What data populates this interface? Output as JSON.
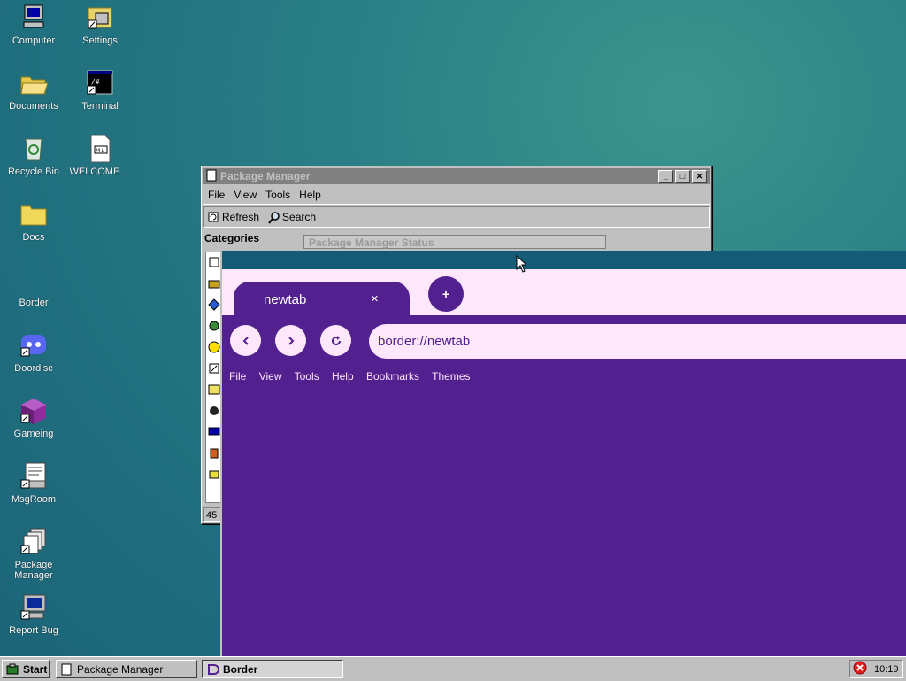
{
  "desktop": {
    "icons": [
      {
        "label": "Computer"
      },
      {
        "label": "Settings"
      },
      {
        "label": "Documents"
      },
      {
        "label": "Terminal"
      },
      {
        "label": "Recycle Bin"
      },
      {
        "label": "WELCOME...."
      },
      {
        "label": "Docs"
      },
      {
        "label": "Border"
      },
      {
        "label": "Doordisc"
      },
      {
        "label": "Gameing"
      },
      {
        "label": "MsgRoom"
      },
      {
        "label": "Package\nManager"
      },
      {
        "label": "Report Bug"
      }
    ]
  },
  "package_manager": {
    "title": "Package Manager",
    "menu": [
      "File",
      "View",
      "Tools",
      "Help"
    ],
    "toolbar": {
      "refresh": "Refresh",
      "search": "Search"
    },
    "categories_label": "Categories",
    "status_label": "Package Manager Status",
    "statusbar": "45"
  },
  "browser": {
    "tab_label": "newtab",
    "tab_close": "×",
    "new_tab": "+",
    "url": "border://newtab",
    "menu": [
      "File",
      "View",
      "Tools",
      "Help",
      "Bookmarks",
      "Themes"
    ],
    "colors": {
      "accent": "#53208f",
      "light": "#fde8fb",
      "titlebar": "#155a77"
    }
  },
  "taskbar": {
    "start": "Start",
    "tasks": [
      "Package Manager",
      "Border"
    ],
    "clock": "10:19"
  }
}
